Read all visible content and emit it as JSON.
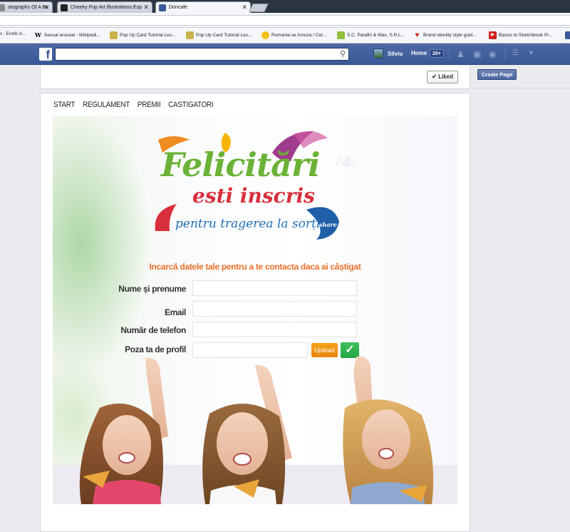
{
  "browser": {
    "tabs": [
      {
        "label": "otographs Of A Bu"
      },
      {
        "label": "Cheeky Pop Art Illustrations Esp"
      },
      {
        "label": "Doncafe"
      }
    ],
    "bookmarks": [
      {
        "label": "s : Erotic A..."
      },
      {
        "label": "Sexual arousal - Wikipedi..."
      },
      {
        "label": "Pop Up Card Tutorial Les..."
      },
      {
        "label": "Pop Up Card Tutorial Les..."
      },
      {
        "label": "Romania se Amuza / Cel..."
      },
      {
        "label": "S.C. Parafin & Wax, S.R.L..."
      },
      {
        "label": "Brand identity style guid..."
      },
      {
        "label": "Basics to Sketchbook Pr..."
      }
    ]
  },
  "facebook": {
    "user_name": "Silviu",
    "home_label": "Home",
    "home_count": "20+",
    "liked_label": "Liked",
    "create_page_label": "Create Page"
  },
  "app": {
    "nav": [
      "START",
      "REGULAMENT",
      "PREMII",
      "CASTIGATORI"
    ],
    "logo": {
      "title": "Felicitări",
      "line2": "esti inscris",
      "line3": "pentru tragerea la sorți",
      "badge": "share"
    },
    "headline": "Incarcă datele tale pentru a te contacta daca ai câștigat",
    "fields": [
      {
        "label": "Nume și prenume",
        "value": ""
      },
      {
        "label": "Email",
        "value": ""
      },
      {
        "label": "Număr de telefon",
        "value": ""
      },
      {
        "label": "Poza ta de profil",
        "value": ""
      }
    ],
    "upload_label": "Upload"
  },
  "colors": {
    "facebook_blue": "#3b5998",
    "headline_orange": "#e8702a",
    "logo_green": "#6bb236",
    "logo_red": "#d8303c",
    "logo_blue": "#1f6fb5",
    "upload_orange": "#f39a17",
    "confirm_green": "#2eb34f"
  }
}
